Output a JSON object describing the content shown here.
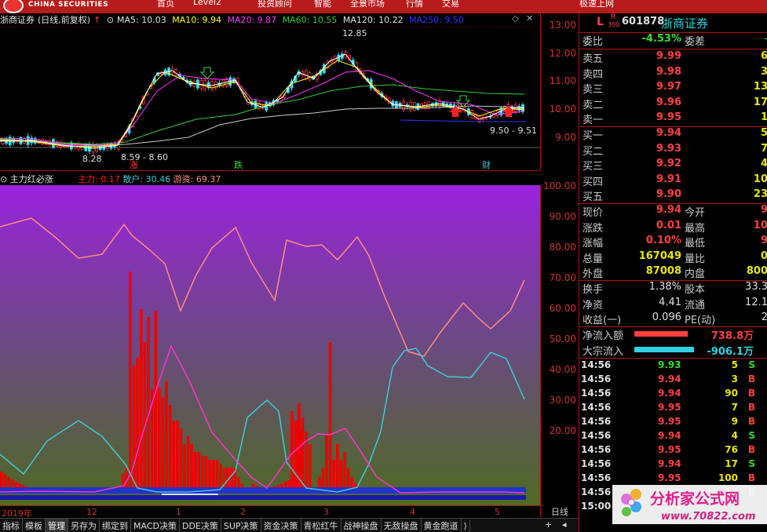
{
  "topbar": {
    "brand": "CHINA SECURITIES",
    "menu": [
      "首页",
      "Level2",
      "投资顾问",
      "智能",
      "全景市场",
      "行情",
      "交易",
      "极速上网"
    ]
  },
  "main_title": {
    "stock": "浙商证券",
    "mode": "(日线,前复权)",
    "ma5": "MA5: 10.03",
    "ma10": "MA10: 9.94",
    "ma20": "MA20: 9.87",
    "ma60": "MA60: 10.55",
    "ma120": "MA120: 10.22",
    "ma250": "MA250: 9.50"
  },
  "main_axis": [
    "13.00",
    "12.00",
    "11.00",
    "10.00",
    "9.00"
  ],
  "price_annotations": {
    "high": "12.85",
    "low1": "8.28",
    "low2": "8.59 - 8.60",
    "right": "9.50 - 9.51",
    "mark_zhang": "涨",
    "mark_die": "跌",
    "mark_cai": "财"
  },
  "indicator_title": {
    "name": "主力红必涨",
    "zhuli": "主力: 0.17",
    "sanhu": "散户: 30.46",
    "youzi": "游资: 69.37"
  },
  "indicator_axis": [
    "100.00",
    "90.00",
    "80.00",
    "70.00",
    "60.00",
    "50.00",
    "40.00",
    "30.00",
    "20.00"
  ],
  "date_axis": [
    "2019年",
    "12",
    "1",
    "2",
    "3",
    "4",
    "5"
  ],
  "period": "日线",
  "tabs": [
    "指标",
    "模板",
    "管理",
    "另存为",
    "绑定到",
    "MACD决策",
    "DDE决策",
    "SUP决策",
    "资金决策",
    "青松红牛",
    "战神操盘",
    "无敌操盘",
    "黄金跑道"
  ],
  "tabs_nav": [
    "+",
    "◂"
  ],
  "stock_header": {
    "l": "L",
    "badge_r": "R",
    "badge_300": "300",
    "code": "601878",
    "name": "浙商证券"
  },
  "weibi": {
    "label": "委比",
    "value": "-4.53%",
    "label2": "委差",
    "value2": "-"
  },
  "asks": [
    {
      "label": "卖五",
      "price": "9.99",
      "vol": "6"
    },
    {
      "label": "卖四",
      "price": "9.98",
      "vol": "3"
    },
    {
      "label": "卖三",
      "price": "9.97",
      "vol": "13"
    },
    {
      "label": "卖二",
      "price": "9.96",
      "vol": "17"
    },
    {
      "label": "卖一",
      "price": "9.95",
      "vol": "1"
    }
  ],
  "bids": [
    {
      "label": "买一",
      "price": "9.94",
      "vol": "5"
    },
    {
      "label": "买二",
      "price": "9.93",
      "vol": "7"
    },
    {
      "label": "买三",
      "price": "9.92",
      "vol": "4"
    },
    {
      "label": "买四",
      "price": "9.91",
      "vol": "10"
    },
    {
      "label": "买五",
      "price": "9.90",
      "vol": "23"
    }
  ],
  "quote": [
    {
      "l": "现价",
      "v": "9.94",
      "l2": "今开",
      "v2": "9"
    },
    {
      "l": "涨跌",
      "v": "0.01",
      "l2": "最高",
      "v2": "10"
    },
    {
      "l": "涨幅",
      "v": "0.10%",
      "l2": "最低",
      "v2": "9"
    },
    {
      "l": "总量",
      "v": "167049",
      "l2": "量比",
      "v2": "0"
    },
    {
      "l": "外盘",
      "v": "87008",
      "l2": "内盘",
      "v2": "800"
    }
  ],
  "fund": [
    {
      "l": "换手",
      "v": "1.38%",
      "l2": "股本",
      "v2": "33.3"
    },
    {
      "l": "净资",
      "v": "4.41",
      "l2": "流通",
      "v2": "12.1"
    },
    {
      "l": "收益(一)",
      "v": "0.096",
      "l2": "PE(动)",
      "v2": "2"
    }
  ],
  "flows": [
    {
      "label": "净流入额",
      "value": "738.8万",
      "color": "#ff4040",
      "bar": 0.85
    },
    {
      "label": "大宗流入",
      "value": "-906.1万",
      "color": "#30d0e0",
      "bar": 0.95
    }
  ],
  "ticks": [
    {
      "time": "14:56",
      "price": "9.93",
      "vol": "5",
      "side": "S"
    },
    {
      "time": "14:56",
      "price": "9.94",
      "vol": "3",
      "side": "B"
    },
    {
      "time": "14:56",
      "price": "9.94",
      "vol": "90",
      "side": "B"
    },
    {
      "time": "14:56",
      "price": "9.95",
      "vol": "7",
      "side": "B"
    },
    {
      "time": "14:56",
      "price": "9.95",
      "vol": "9",
      "side": "B"
    },
    {
      "time": "14:56",
      "price": "9.94",
      "vol": "4",
      "side": "S"
    },
    {
      "time": "14:56",
      "price": "9.95",
      "vol": "76",
      "side": "B"
    },
    {
      "time": "14:56",
      "price": "9.94",
      "vol": "17",
      "side": "S"
    },
    {
      "time": "14:56",
      "price": "9.95",
      "vol": "100",
      "side": "B"
    },
    {
      "time": "14:56",
      "price": "9.95",
      "vol": "14",
      "side": "B"
    },
    {
      "time": "15:00",
      "price": "9.94",
      "vol": "",
      "side": ""
    }
  ],
  "watermark": {
    "title": "分析家公式网",
    "url": "www.70822.com"
  },
  "colors": {
    "up": "#ff4040",
    "down": "#33dd33",
    "ma5": "#ffffff",
    "ma10": "#ffff00",
    "ma20": "#ff33ff",
    "ma60": "#33cc33",
    "ma120": "#cccccc",
    "ma250": "#3333ff",
    "zhuli": "#ff0000",
    "sanhu": "#40c8d8",
    "youzi": "#ff8c80"
  }
}
